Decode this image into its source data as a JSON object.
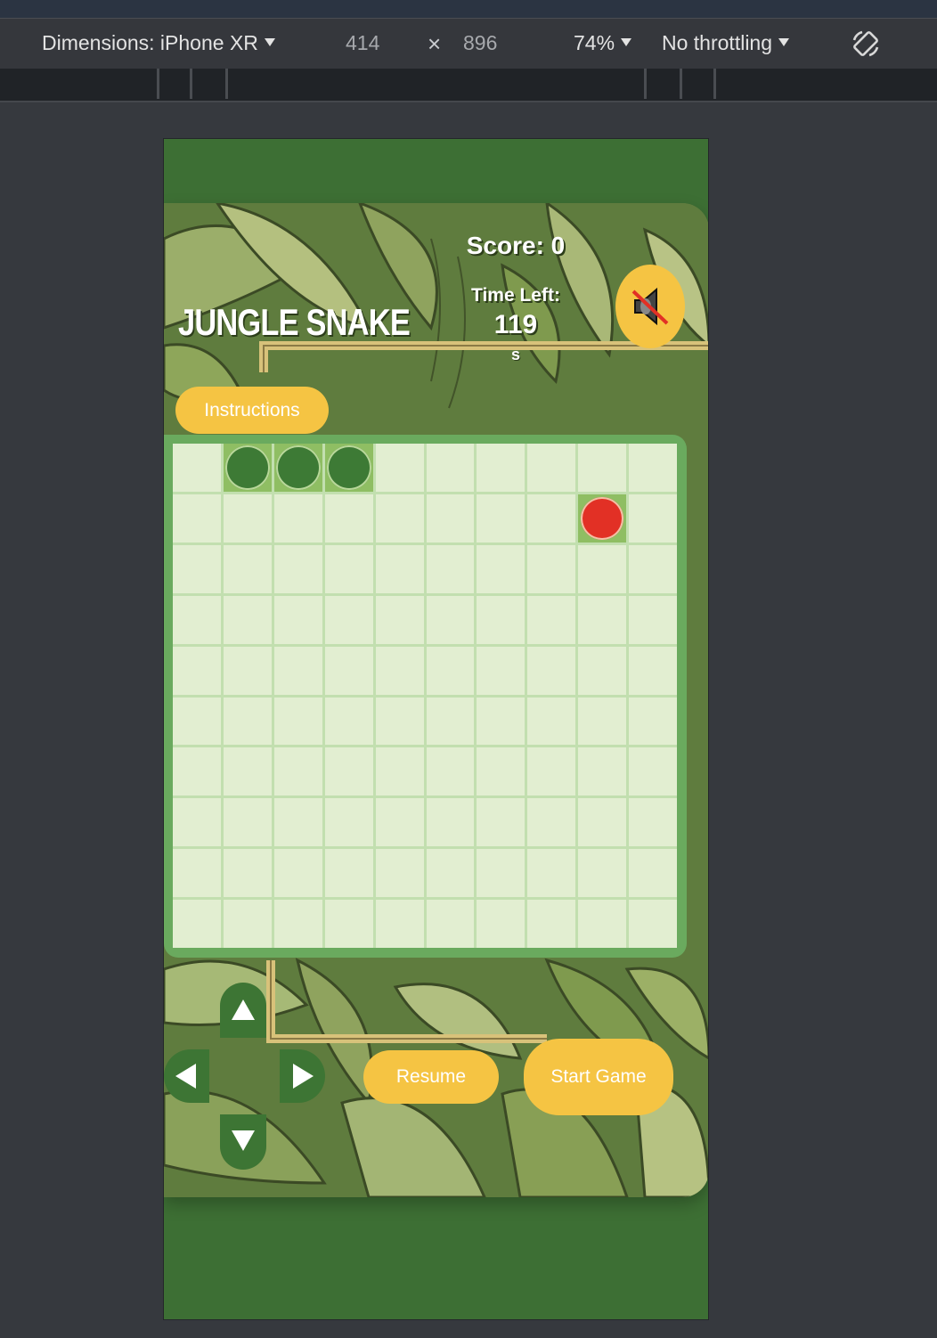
{
  "devtools": {
    "dimensions_label": "Dimensions: iPhone XR",
    "width": "414",
    "times": "×",
    "height": "896",
    "zoom": "74%",
    "throttling": "No throttling",
    "rotate_icon": "rotate-icon"
  },
  "game": {
    "title": "JUNGLE SNAKE",
    "score_label": "Score: 0",
    "time_label": "Time Left:",
    "time_value": "119",
    "time_unit": "s",
    "sound_icon": "muted-speaker-icon",
    "instructions_label": "Instructions",
    "resume_label": "Resume",
    "start_label": "Start Game"
  },
  "board": {
    "rows": 10,
    "cols": 10,
    "snake_cells": [
      [
        0,
        1
      ],
      [
        0,
        2
      ],
      [
        0,
        3
      ]
    ],
    "food_cell": [
      1,
      8
    ]
  },
  "controls": {
    "up_icon": "arrow-up-icon",
    "down_icon": "arrow-down-icon",
    "left_icon": "arrow-left-icon",
    "right_icon": "arrow-right-icon"
  },
  "colors": {
    "device_bg": "#3d6f34",
    "board_border": "#6aaa5e",
    "cell": "#e2eed1",
    "snake": "#3d7a35",
    "food": "#e23025",
    "button": "#f5c443",
    "dpad": "#3d7534"
  }
}
